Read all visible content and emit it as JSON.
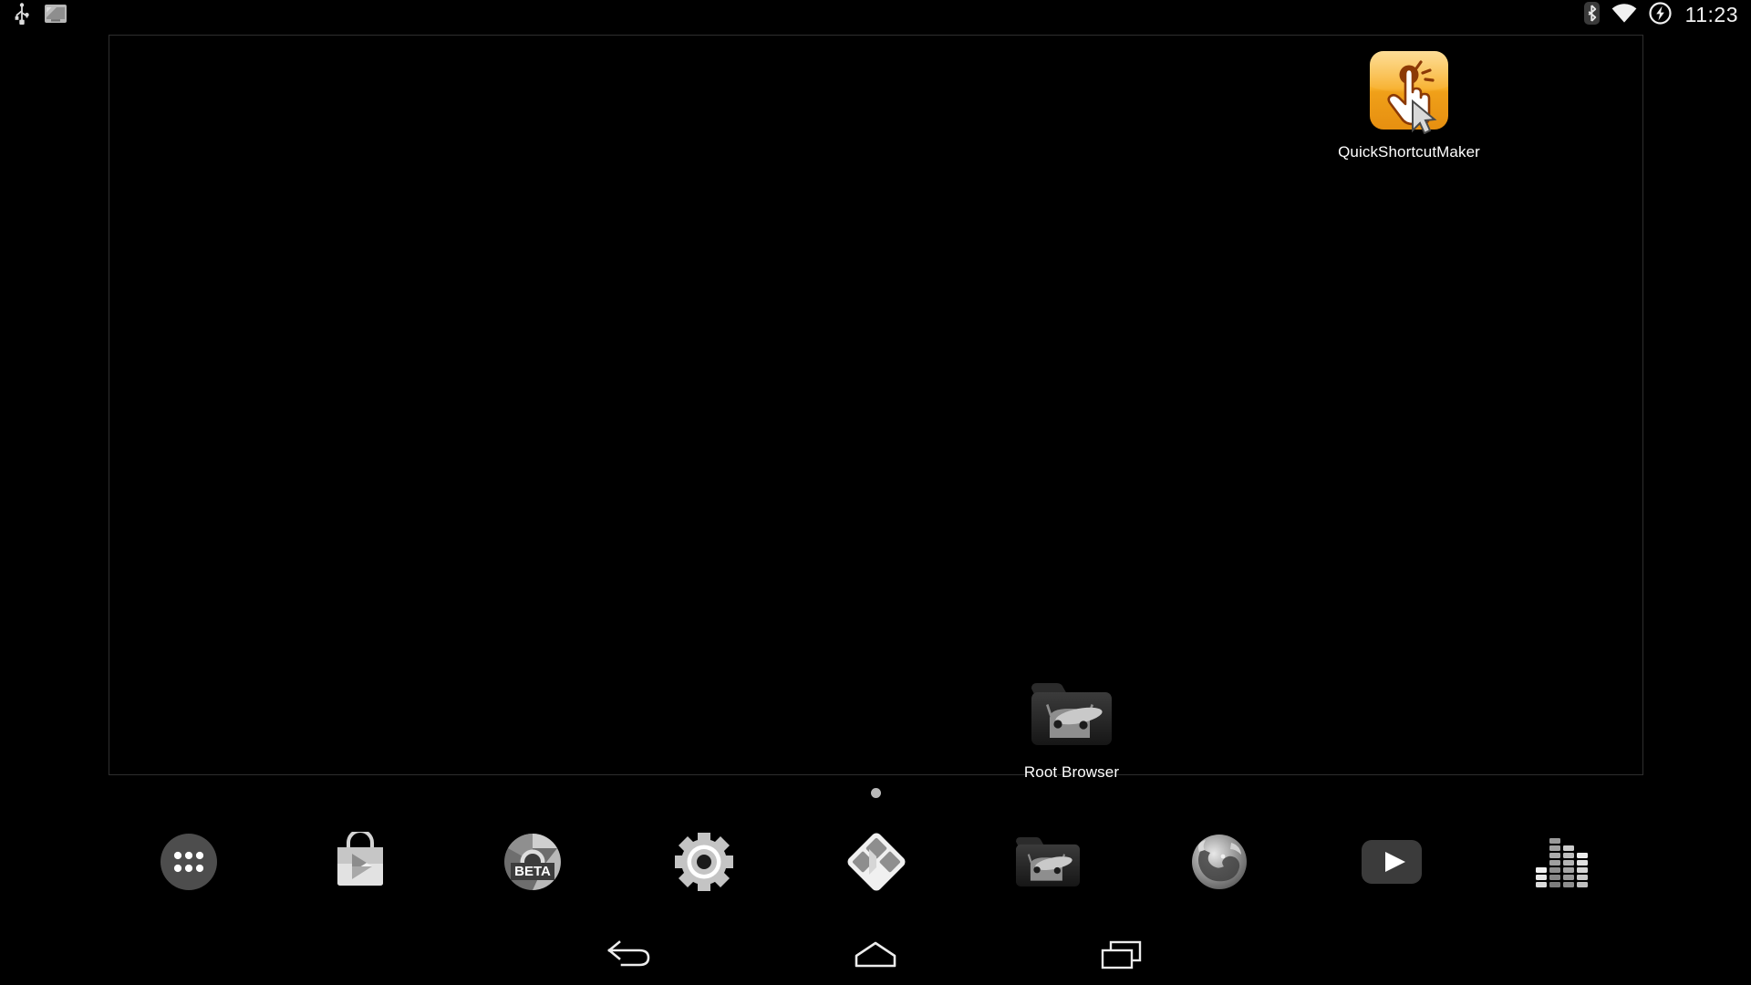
{
  "statusbar": {
    "left_icons": [
      {
        "name": "usb-icon",
        "label": "USB connected"
      },
      {
        "name": "screenshot-notification-icon",
        "label": "Screenshot captured"
      }
    ],
    "right_icons": [
      {
        "name": "bluetooth-icon",
        "label": "Bluetooth on"
      },
      {
        "name": "wifi-icon",
        "label": "Wi-Fi connected"
      },
      {
        "name": "charging-bolt-icon",
        "label": "Charging"
      }
    ],
    "clock": "11:23"
  },
  "workspace": {
    "shortcuts": [
      {
        "id": "quickshortcutmaker",
        "label": "QuickShortcutMaker",
        "icon": "quickshortcutmaker-icon"
      },
      {
        "id": "rootbrowser",
        "label": "Root Browser",
        "icon": "root-browser-folder-icon"
      }
    ],
    "page_indicator": {
      "pages": 1,
      "current": 1
    }
  },
  "dock": {
    "items": [
      {
        "id": "app-drawer",
        "label": "Apps",
        "icon": "app-drawer-icon"
      },
      {
        "id": "play-store",
        "label": "Play Store",
        "icon": "play-store-icon"
      },
      {
        "id": "chrome-beta",
        "label": "Chrome Beta",
        "icon": "chrome-beta-icon",
        "badge": "BETA"
      },
      {
        "id": "settings",
        "label": "Settings",
        "icon": "settings-gear-icon"
      },
      {
        "id": "kodi",
        "label": "Kodi",
        "icon": "kodi-icon"
      },
      {
        "id": "root-browser",
        "label": "Root Browser",
        "icon": "root-browser-folder-icon"
      },
      {
        "id": "firefox",
        "label": "Firefox",
        "icon": "firefox-icon"
      },
      {
        "id": "youtube",
        "label": "YouTube",
        "icon": "youtube-icon"
      },
      {
        "id": "poweramp",
        "label": "Poweramp",
        "icon": "equalizer-icon"
      }
    ]
  },
  "navbar": {
    "buttons": [
      {
        "id": "back",
        "label": "Back",
        "icon": "back-arrow-icon"
      },
      {
        "id": "home",
        "label": "Home",
        "icon": "home-icon"
      },
      {
        "id": "recents",
        "label": "Recents",
        "icon": "recents-icon"
      }
    ]
  },
  "colors": {
    "background": "#000000",
    "workspace_border": "#2e2e2e",
    "status_text": "#f2f2f2",
    "label_text": "#ffffff",
    "qsm_orange": "#f5a623",
    "qsm_orange_dark": "#e08a12",
    "page_dot": "#b9b9b9"
  }
}
